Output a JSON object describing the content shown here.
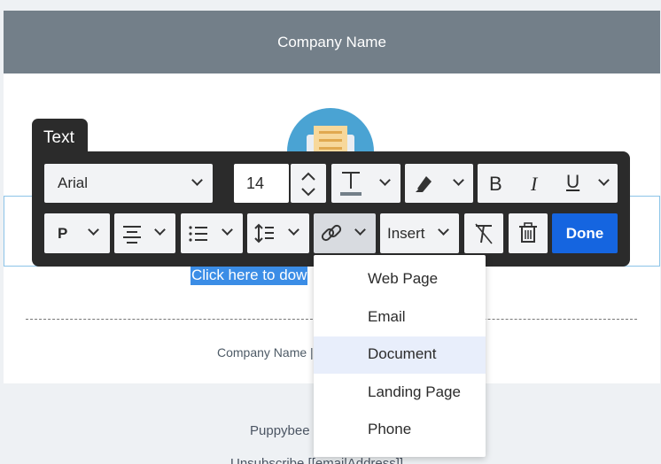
{
  "email": {
    "header_title": "Company Name",
    "link_text": "Click here to dow",
    "footer_line": "Company Name |",
    "below_line1": "Puppybee",
    "below_line2": "Unsubscribe [[emailAddress]]"
  },
  "editor": {
    "tab_label": "Text",
    "font_family": "Arial",
    "font_size": "14",
    "paragraph_style": "P",
    "insert_label": "Insert",
    "done_label": "Done"
  },
  "link_menu": {
    "items": [
      "Web Page",
      "Email",
      "Document",
      "Landing Page",
      "Phone"
    ],
    "highlighted": "Document"
  },
  "icons": [
    "envelope-logo-icon",
    "text-color-icon",
    "highlighter-icon",
    "bold-icon",
    "italic-icon",
    "underline-icon",
    "align-center-icon",
    "bullet-list-icon",
    "line-height-icon",
    "link-icon",
    "clear-format-icon",
    "trash-icon",
    "chevron-down-icon",
    "stepper-up-icon",
    "stepper-down-icon"
  ],
  "colors": {
    "header_bg": "#737f89",
    "toolbar_bg": "#2b2b2b",
    "done_bg": "#1565e0",
    "link_highlight": "#3b8de6",
    "menu_active": "#e8eefb"
  }
}
